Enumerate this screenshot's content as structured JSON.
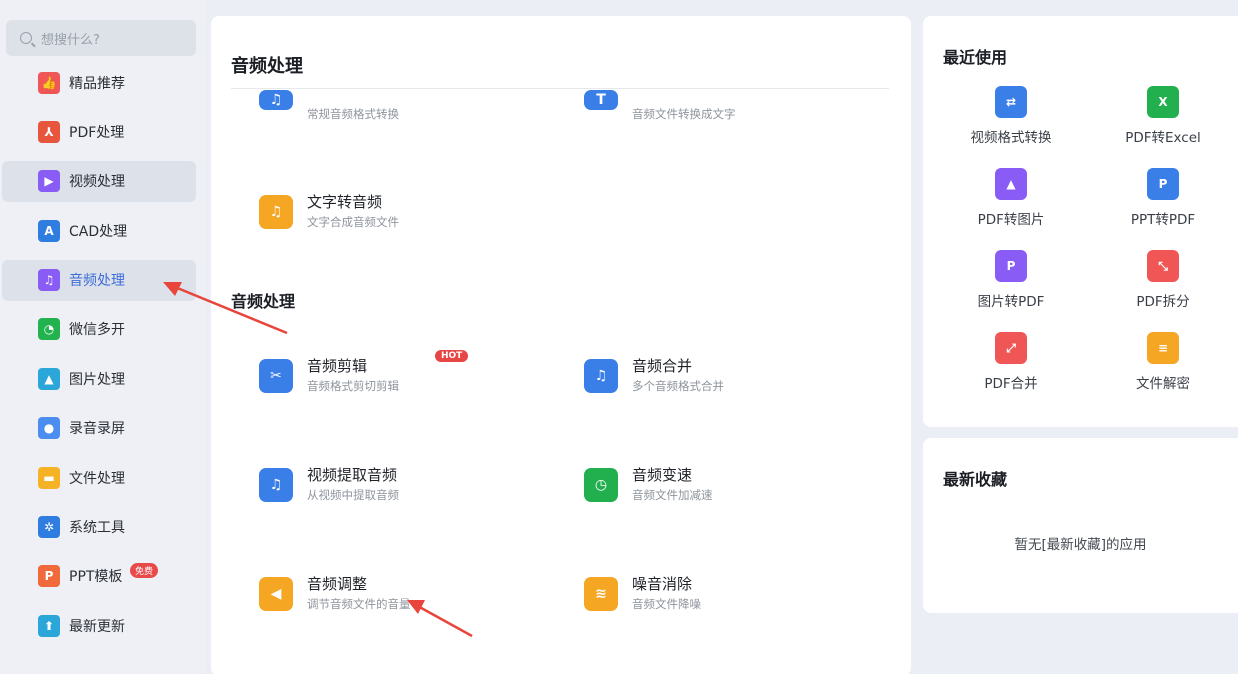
{
  "search": {
    "placeholder": "想搜什么?"
  },
  "sidebar": {
    "items": [
      {
        "label": "精品推荐",
        "icon": "thumbs-up-icon",
        "color": "#f05656",
        "glyph": "👍"
      },
      {
        "label": "PDF处理",
        "icon": "pdf-icon",
        "color": "#e8553d",
        "glyph": "⅄"
      },
      {
        "label": "视频处理",
        "icon": "video-play-icon",
        "color": "#8a5cf6",
        "glyph": "▶"
      },
      {
        "label": "CAD处理",
        "icon": "cad-icon",
        "color": "#2f7de1",
        "glyph": "A"
      },
      {
        "label": "音频处理",
        "icon": "music-note-icon",
        "color": "#8a5cf6",
        "glyph": "♫"
      },
      {
        "label": "微信多开",
        "icon": "wechat-icon",
        "color": "#22b34f",
        "glyph": "◔"
      },
      {
        "label": "图片处理",
        "icon": "image-icon",
        "color": "#2aa6d8",
        "glyph": "▲"
      },
      {
        "label": "录音录屏",
        "icon": "microphone-icon",
        "color": "#4b8df0",
        "glyph": "●"
      },
      {
        "label": "文件处理",
        "icon": "folder-icon",
        "color": "#f5b225",
        "glyph": "▬"
      },
      {
        "label": "系统工具",
        "icon": "gear-icon",
        "color": "#2f7de1",
        "glyph": "✲"
      },
      {
        "label": "PPT模板",
        "icon": "ppt-icon",
        "color": "#f06a3c",
        "glyph": "P",
        "badge": "免费"
      },
      {
        "label": "最新更新",
        "icon": "upload-icon",
        "color": "#2aa6d8",
        "glyph": "⬆"
      }
    ]
  },
  "main": {
    "section1_title": "音频处理",
    "top_tools": [
      {
        "desc": "常规音频格式转换",
        "icon": "audio-convert-icon",
        "color": "#3a7ee8",
        "glyph": "♫"
      },
      {
        "desc": "音频文件转换成文字",
        "icon": "audio-to-text-icon",
        "color": "#3a7ee8",
        "glyph": "T"
      }
    ],
    "tts": {
      "name": "文字转音频",
      "desc": "文字合成音频文件",
      "icon": "text-to-audio-icon",
      "color": "#f5a623",
      "glyph": "♫"
    },
    "section2_title": "音频处理",
    "tools": [
      {
        "name": "音频剪辑",
        "desc": "音频格式剪切剪辑",
        "icon": "audio-cut-icon",
        "color": "#3a7ee8",
        "glyph": "✂",
        "badge": "HOT"
      },
      {
        "name": "音频合并",
        "desc": "多个音频格式合并",
        "icon": "audio-merge-icon",
        "color": "#3a7ee8",
        "glyph": "♫"
      },
      {
        "name": "视频提取音频",
        "desc": "从视频中提取音频",
        "icon": "extract-audio-icon",
        "color": "#3a7ee8",
        "glyph": "♫"
      },
      {
        "name": "音频变速",
        "desc": "音频文件加减速",
        "icon": "audio-speed-icon",
        "color": "#22b04f",
        "glyph": "◷"
      },
      {
        "name": "音频调整",
        "desc": "调节音频文件的音量",
        "icon": "volume-icon",
        "color": "#f5a623",
        "glyph": "◀"
      },
      {
        "name": "噪音消除",
        "desc": "音频文件降噪",
        "icon": "noise-reduction-icon",
        "color": "#f5a623",
        "glyph": "≋"
      }
    ]
  },
  "recent": {
    "title": "最近使用",
    "items": [
      {
        "label": "视频格式转换",
        "icon": "video-convert-icon",
        "color": "#3a7ee8",
        "glyph": "⇄"
      },
      {
        "label": "PDF转Excel",
        "icon": "pdf-to-excel-icon",
        "color": "#22b04f",
        "glyph": "X"
      },
      {
        "label": "PDF转图片",
        "icon": "pdf-to-image-icon",
        "color": "#8a5cf6",
        "glyph": "▲"
      },
      {
        "label": "PPT转PDF",
        "icon": "ppt-to-pdf-icon",
        "color": "#3a7ee8",
        "glyph": "P"
      },
      {
        "label": "图片转PDF",
        "icon": "image-to-pdf-icon",
        "color": "#8a5cf6",
        "glyph": "P"
      },
      {
        "label": "PDF拆分",
        "icon": "pdf-split-icon",
        "color": "#f05656",
        "glyph": "⤡"
      },
      {
        "label": "PDF合并",
        "icon": "pdf-merge-icon",
        "color": "#f05656",
        "glyph": "⤢"
      },
      {
        "label": "文件解密",
        "icon": "file-decrypt-icon",
        "color": "#f5a623",
        "glyph": "≡"
      }
    ]
  },
  "favorites": {
    "title": "最新收藏",
    "empty_text": "暂无[最新收藏]的应用"
  }
}
